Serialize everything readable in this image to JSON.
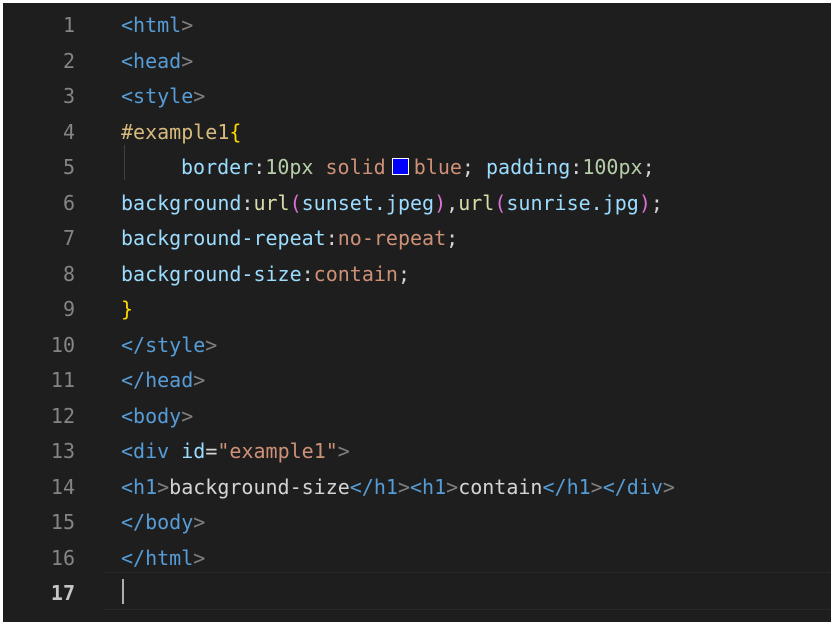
{
  "editor": {
    "current_line": 17,
    "line_numbers": [
      "1",
      "2",
      "3",
      "4",
      "5",
      "6",
      "7",
      "8",
      "9",
      "10",
      "11",
      "12",
      "13",
      "14",
      "15",
      "16",
      "17"
    ],
    "colors": {
      "background": "#1e1e1e",
      "tag": "#569cd6",
      "bracket": "#808080",
      "selector": "#d7ba7d",
      "property": "#9cdcfe",
      "string_value": "#ce9178",
      "number": "#b5cea8",
      "function": "#dcdcaa",
      "paren": "#da70d6",
      "curly": "#ffd700",
      "color_swatch": "#0000ff"
    },
    "lines": [
      [
        {
          "t": "tag",
          "v": "<html"
        },
        {
          "t": "br",
          "v": ">"
        }
      ],
      [
        {
          "t": "tag",
          "v": "<head"
        },
        {
          "t": "br",
          "v": ">"
        }
      ],
      [
        {
          "t": "tag",
          "v": "<style"
        },
        {
          "t": "br",
          "v": ">"
        }
      ],
      [
        {
          "t": "sel",
          "v": "#example1"
        },
        {
          "t": "curly",
          "v": "{"
        }
      ],
      [
        {
          "t": "prop",
          "v": "border"
        },
        {
          "t": "txt",
          "v": ":"
        },
        {
          "t": "num",
          "v": "10px"
        },
        {
          "t": "txt",
          "v": " "
        },
        {
          "t": "val",
          "v": "solid"
        },
        {
          "t": "swatch",
          "v": "color-swatch-blue"
        },
        {
          "t": "val",
          "v": "blue"
        },
        {
          "t": "txt",
          "v": "; "
        },
        {
          "t": "prop",
          "v": "padding"
        },
        {
          "t": "txt",
          "v": ":"
        },
        {
          "t": "num",
          "v": "100px"
        },
        {
          "t": "txt",
          "v": ";"
        }
      ],
      [
        {
          "t": "prop",
          "v": "background"
        },
        {
          "t": "txt",
          "v": ":"
        },
        {
          "t": "fn",
          "v": "url"
        },
        {
          "t": "paren",
          "v": "("
        },
        {
          "t": "prop",
          "v": "sunset.jpeg"
        },
        {
          "t": "paren",
          "v": ")"
        },
        {
          "t": "txt",
          "v": ","
        },
        {
          "t": "fn",
          "v": "url"
        },
        {
          "t": "paren",
          "v": "("
        },
        {
          "t": "prop",
          "v": "sunrise.jpg"
        },
        {
          "t": "paren",
          "v": ")"
        },
        {
          "t": "txt",
          "v": ";"
        }
      ],
      [
        {
          "t": "prop",
          "v": "background-repeat"
        },
        {
          "t": "txt",
          "v": ":"
        },
        {
          "t": "val",
          "v": "no-repeat"
        },
        {
          "t": "txt",
          "v": ";"
        }
      ],
      [
        {
          "t": "prop",
          "v": "background-size"
        },
        {
          "t": "txt",
          "v": ":"
        },
        {
          "t": "val",
          "v": "contain"
        },
        {
          "t": "txt",
          "v": ";"
        }
      ],
      [
        {
          "t": "curly",
          "v": "}"
        }
      ],
      [
        {
          "t": "tag",
          "v": "</style"
        },
        {
          "t": "br",
          "v": ">"
        }
      ],
      [
        {
          "t": "tag",
          "v": "</head"
        },
        {
          "t": "br",
          "v": ">"
        }
      ],
      [
        {
          "t": "tag",
          "v": "<body"
        },
        {
          "t": "br",
          "v": ">"
        }
      ],
      [
        {
          "t": "tag",
          "v": "<div"
        },
        {
          "t": "txt",
          "v": " "
        },
        {
          "t": "prop",
          "v": "id"
        },
        {
          "t": "txt",
          "v": "="
        },
        {
          "t": "val",
          "v": "\"example1\""
        },
        {
          "t": "br",
          "v": ">"
        }
      ],
      [
        {
          "t": "tag",
          "v": "<h1"
        },
        {
          "t": "br",
          "v": ">"
        },
        {
          "t": "txt",
          "v": "background-size"
        },
        {
          "t": "tag",
          "v": "</h1"
        },
        {
          "t": "br",
          "v": ">"
        },
        {
          "t": "tag",
          "v": "<h1"
        },
        {
          "t": "br",
          "v": ">"
        },
        {
          "t": "txt",
          "v": "contain"
        },
        {
          "t": "tag",
          "v": "</h1"
        },
        {
          "t": "br",
          "v": ">"
        },
        {
          "t": "tag",
          "v": "</div"
        },
        {
          "t": "br",
          "v": ">"
        }
      ],
      [
        {
          "t": "tag",
          "v": "</body"
        },
        {
          "t": "br",
          "v": ">"
        }
      ],
      [
        {
          "t": "tag",
          "v": "</html"
        },
        {
          "t": "br",
          "v": ">"
        }
      ],
      []
    ]
  }
}
